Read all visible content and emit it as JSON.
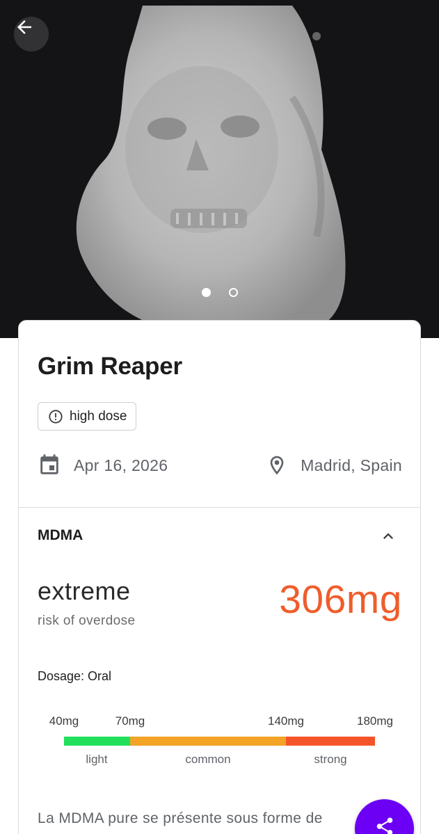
{
  "hero": {
    "back_icon": "arrow-back-icon",
    "carousel": {
      "count": 2,
      "active_index": 0
    }
  },
  "pill": {
    "name": "Grim Reaper",
    "badge": {
      "icon": "alert-circle-icon",
      "label": "high dose"
    },
    "date": {
      "icon": "calendar-icon",
      "value": "Apr 16, 2026"
    },
    "location": {
      "icon": "location-pin-icon",
      "value": "Madrid, Spain"
    }
  },
  "substance": {
    "name": "MDMA",
    "expanded": true,
    "toggle_icon": "chevron-up-icon",
    "risk_level": "extreme",
    "risk_label": "risk of overdose",
    "amount": "306mg",
    "amount_color": "#ef5d2b",
    "dosage_route": "Dosage: Oral",
    "dosage_scale": {
      "ticks": [
        "40mg",
        "70mg",
        "140mg",
        "180mg"
      ],
      "ranges": [
        {
          "label": "light",
          "color": "#22e05c"
        },
        {
          "label": "common",
          "color": "#f3a325"
        },
        {
          "label": "strong",
          "color": "#f5542a"
        }
      ]
    },
    "description": "La MDMA pure se présente sous forme de"
  },
  "share_button": {
    "icon": "share-icon",
    "color": "#6b00f5"
  }
}
